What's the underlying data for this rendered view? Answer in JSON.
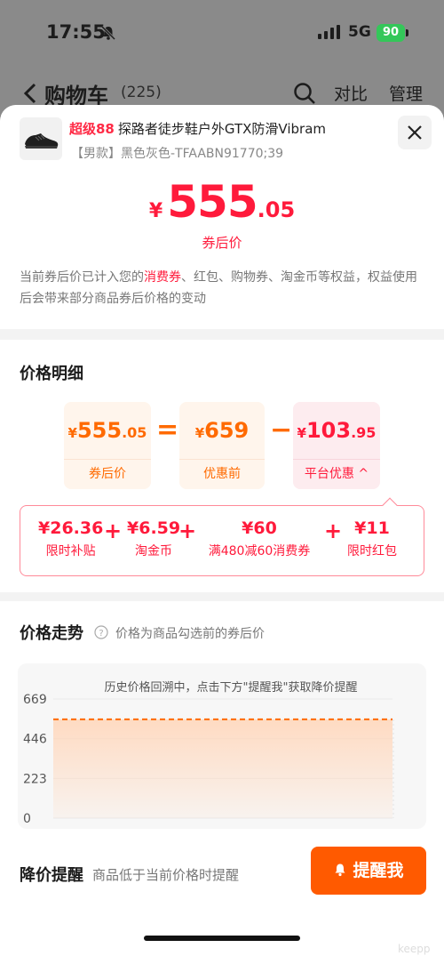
{
  "status": {
    "time": "17:55",
    "network": "5G",
    "battery": "90"
  },
  "nav": {
    "title": "购物车",
    "count": "(225)",
    "compare": "对比",
    "manage": "管理"
  },
  "product": {
    "tag": "超级88",
    "title": "探路者徒步鞋户外GTX防滑Vibram",
    "sku": "【男款】黑色灰色-TFAABN91770;39"
  },
  "price": {
    "currency": "¥",
    "int": "555",
    "dec": ".05",
    "label": "券后价"
  },
  "note": {
    "pre": "当前券后价已计入您的",
    "highlight": "消费券",
    "post": "、红包、购物券、淘金币等权益，权益使用后会带来部分商品券后价格的变动"
  },
  "detail": {
    "title": "价格明细",
    "boxes": [
      {
        "yen": "¥",
        "int": "555",
        "dec": ".05",
        "label": "券后价"
      },
      {
        "yen": "¥",
        "int": "659",
        "dec": "",
        "label": "优惠前"
      },
      {
        "yen": "¥",
        "int": "103",
        "dec": ".95",
        "label": "平台优惠 ^"
      }
    ],
    "equals": "=",
    "minus": "−",
    "breakdown": [
      {
        "value": "¥26.36",
        "label": "限时补贴"
      },
      {
        "value": "¥6.59",
        "label": "淘金币"
      },
      {
        "value": "¥60",
        "label": "满480减60消费券"
      },
      {
        "value": "¥11",
        "label": "限时红包"
      }
    ],
    "plus": "+"
  },
  "trend": {
    "title": "价格走势",
    "subtitle": "价格为商品勾选前的券后价",
    "hint": "历史价格回溯中，点击下方\"提醒我\"获取降价提醒"
  },
  "chart_data": {
    "type": "area",
    "yticks": [
      "669",
      "446",
      "223",
      "0"
    ],
    "ylim": [
      0,
      669
    ],
    "series": [
      {
        "values": [
          555.05,
          555.05
        ]
      }
    ],
    "colors": {
      "line": "#ff6a00",
      "fill": "#ffd9bf"
    }
  },
  "alert": {
    "title": "降价提醒",
    "subtitle": "商品低于当前价格时提醒",
    "button": "提醒我"
  },
  "watermark": "keepp",
  "colors": {
    "red": "#ff1a3b",
    "orange": "#ff6a00",
    "button": "#ff5a00"
  }
}
